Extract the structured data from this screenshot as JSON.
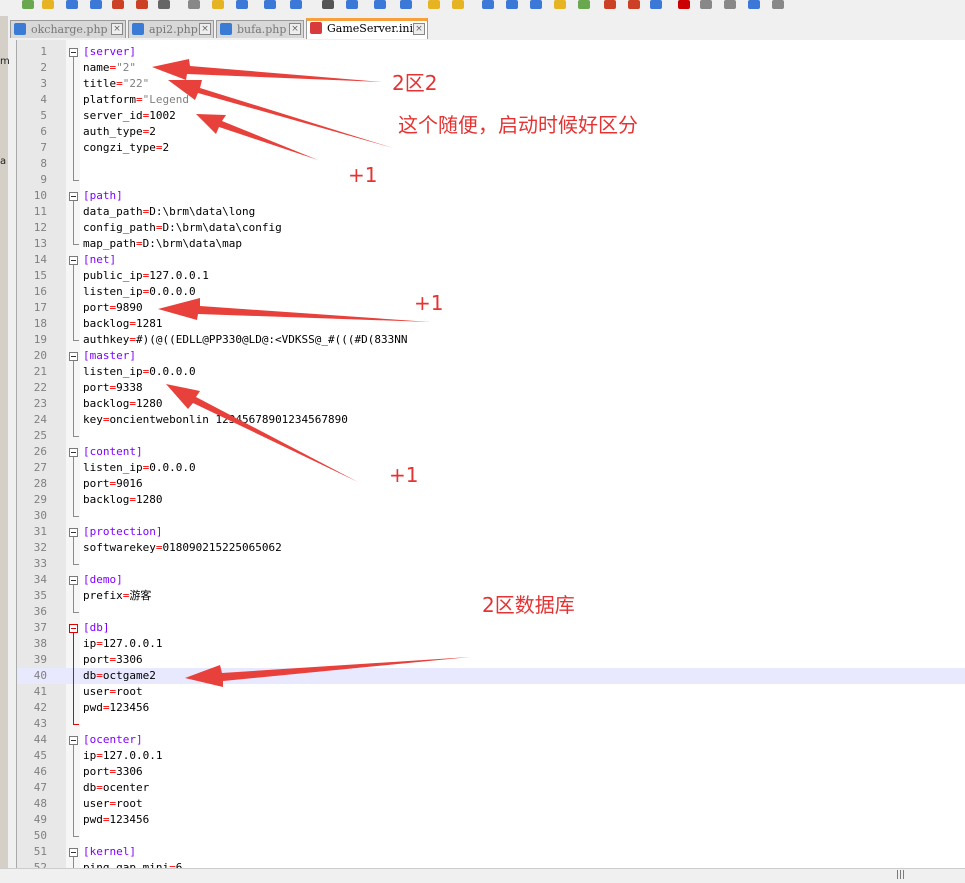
{
  "tabs": [
    {
      "label": "okcharge.php",
      "active": false
    },
    {
      "label": "api2.php",
      "active": false
    },
    {
      "label": "bufa.php",
      "active": false
    },
    {
      "label": "GameServer.ini",
      "active": true
    }
  ],
  "left_fragments": [
    "m",
    "a"
  ],
  "lines": [
    {
      "n": "1",
      "text": "[server]"
    },
    {
      "n": "2",
      "text": "name=\"2\""
    },
    {
      "n": "3",
      "text": "title=\"22\""
    },
    {
      "n": "4",
      "text": "platform=\"Legend"
    },
    {
      "n": "5",
      "text": "server_id=1002"
    },
    {
      "n": "6",
      "text": "auth_type=2"
    },
    {
      "n": "7",
      "text": "congzi_type=2"
    },
    {
      "n": "8",
      "text": ""
    },
    {
      "n": "9",
      "text": ""
    },
    {
      "n": "10",
      "text": "[path]"
    },
    {
      "n": "11",
      "text": "data_path=D:\\brm\\data\\long"
    },
    {
      "n": "12",
      "text": "config_path=D:\\brm\\data\\config"
    },
    {
      "n": "13",
      "text": "map_path=D:\\brm\\data\\map"
    },
    {
      "n": "14",
      "text": "[net]"
    },
    {
      "n": "15",
      "text": "public_ip=127.0.0.1"
    },
    {
      "n": "16",
      "text": "listen_ip=0.0.0.0"
    },
    {
      "n": "17",
      "text": "port=9890"
    },
    {
      "n": "18",
      "text": "backlog=1281"
    },
    {
      "n": "19",
      "text": "authkey=#)(@((EDLL@PP330@LD@:<VDKSS@_#(((#D(833NN"
    },
    {
      "n": "20",
      "text": "[master]"
    },
    {
      "n": "21",
      "text": "listen_ip=0.0.0.0"
    },
    {
      "n": "22",
      "text": "port=9338"
    },
    {
      "n": "23",
      "text": "backlog=1280"
    },
    {
      "n": "24",
      "text": "key=oncientwebonlin 12345678901234567890"
    },
    {
      "n": "25",
      "text": ""
    },
    {
      "n": "26",
      "text": "[content]"
    },
    {
      "n": "27",
      "text": "listen_ip=0.0.0.0"
    },
    {
      "n": "28",
      "text": "port=9016"
    },
    {
      "n": "29",
      "text": "backlog=1280"
    },
    {
      "n": "30",
      "text": ""
    },
    {
      "n": "31",
      "text": "[protection]"
    },
    {
      "n": "32",
      "text": "softwarekey=018090215225065062"
    },
    {
      "n": "33",
      "text": ""
    },
    {
      "n": "34",
      "text": "[demo]"
    },
    {
      "n": "35",
      "text": "prefix=游客"
    },
    {
      "n": "36",
      "text": ""
    },
    {
      "n": "37",
      "text": "[db]"
    },
    {
      "n": "38",
      "text": "ip=127.0.0.1"
    },
    {
      "n": "39",
      "text": "port=3306"
    },
    {
      "n": "40",
      "text": "db=octgame2"
    },
    {
      "n": "41",
      "text": "user=root"
    },
    {
      "n": "42",
      "text": "pwd=123456"
    },
    {
      "n": "43",
      "text": ""
    },
    {
      "n": "44",
      "text": "[ocenter]"
    },
    {
      "n": "45",
      "text": "ip=127.0.0.1"
    },
    {
      "n": "46",
      "text": "port=3306"
    },
    {
      "n": "47",
      "text": "db=ocenter"
    },
    {
      "n": "48",
      "text": "user=root"
    },
    {
      "n": "49",
      "text": "pwd=123456"
    },
    {
      "n": "50",
      "text": ""
    },
    {
      "n": "51",
      "text": "[kernel]"
    },
    {
      "n": "52",
      "text": "ping_gap_mini=6"
    }
  ],
  "annotations": [
    {
      "text": "2区2"
    },
    {
      "text": "这个随便，启动时候好区分"
    },
    {
      "text": "+1"
    },
    {
      "text": "+1"
    },
    {
      "text": "+1"
    },
    {
      "text": "2区数据库"
    }
  ],
  "colors": {
    "section": "#8000ff",
    "operator": "#ff0000",
    "annotation": "#e53333",
    "current_line": "#e8e8ff",
    "active_tab_accent": "#f9a03c"
  }
}
